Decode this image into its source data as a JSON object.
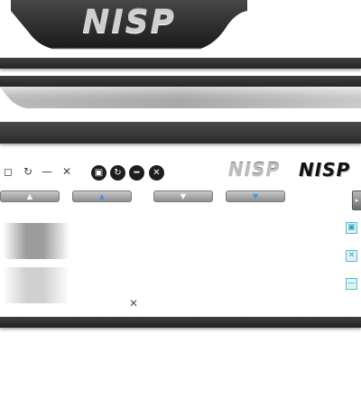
{
  "header": {
    "logo_text": "NISP"
  },
  "window_controls_small": {
    "restore": "◻",
    "refresh": "↻",
    "minimize": "—",
    "close": "✕"
  },
  "window_controls_round": {
    "restore": "▣",
    "refresh": "↻",
    "minimize": "━",
    "close": "✕"
  },
  "brand_logos": {
    "silver": "NISP",
    "black": "NISP"
  },
  "nav_buttons": {
    "up": "▲",
    "up_active": "▲",
    "down": "▼",
    "down_active": "▼"
  },
  "side_toggle": "▸",
  "side_icons": {
    "window": "▣",
    "close": "✕",
    "minimize": "—"
  },
  "tool_icon": "✕",
  "colors": {
    "bar_dark": "#2c2c2c",
    "accent_blue": "#4a90d9",
    "side_icon_border": "#5fb9c8"
  }
}
